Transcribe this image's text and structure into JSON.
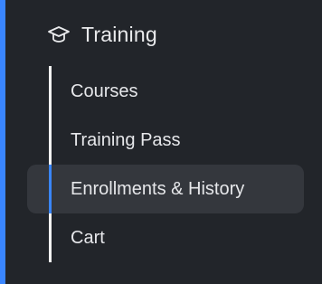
{
  "theme": {
    "accent": "#3a86ff",
    "background": "#22252a",
    "active_bg": "#34373d",
    "text": "#e9eaec"
  },
  "section": {
    "title": "Training",
    "icon": "graduation-cap-icon"
  },
  "items": [
    {
      "label": "Courses",
      "active": false
    },
    {
      "label": "Training Pass",
      "active": false
    },
    {
      "label": "Enrollments & History",
      "active": true
    },
    {
      "label": "Cart",
      "active": false
    }
  ]
}
